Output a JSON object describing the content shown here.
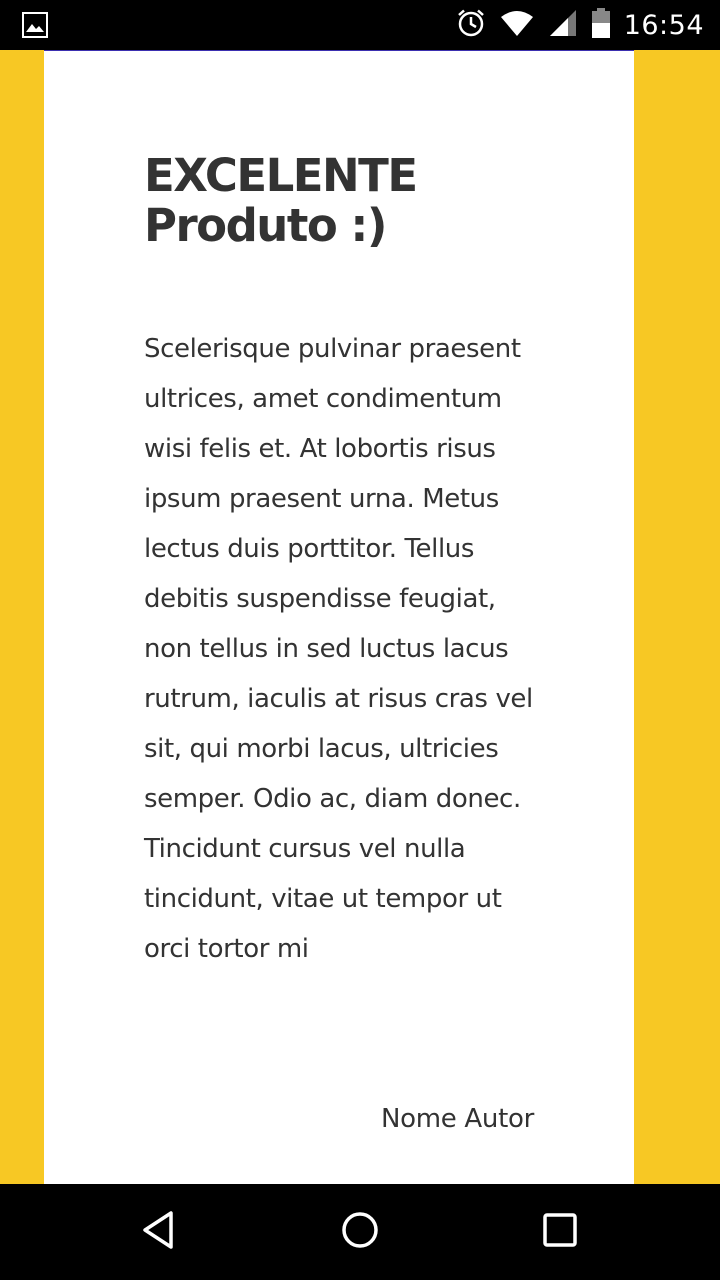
{
  "status_bar": {
    "time": "16:54",
    "icons": [
      "gallery-notification-icon",
      "alarm-icon",
      "wifi-icon",
      "cell-signal-icon",
      "battery-icon"
    ]
  },
  "card": {
    "title": "EXCELENTE Produto :)",
    "body": "Scelerisque pulvinar praesent ultrices, amet condimentum wisi felis et. At lobortis risus ipsum praesent urna. Metus lectus duis porttitor. Tellus debitis suspendisse feugiat, non tellus in sed luctus lacus rutrum, iaculis at risus cras vel sit, qui morbi lacus, ultricies semper. Odio ac, diam donec. Tincidunt cursus vel nulla tincidunt, vitae ut tempor ut orci tortor mi",
    "author": "Nome Autor"
  },
  "colors": {
    "background": "#f7c824",
    "card": "#ffffff",
    "text": "#333333",
    "system_bars": "#000000"
  },
  "nav_bar": {
    "buttons": [
      "back-icon",
      "home-icon",
      "recents-icon"
    ]
  }
}
